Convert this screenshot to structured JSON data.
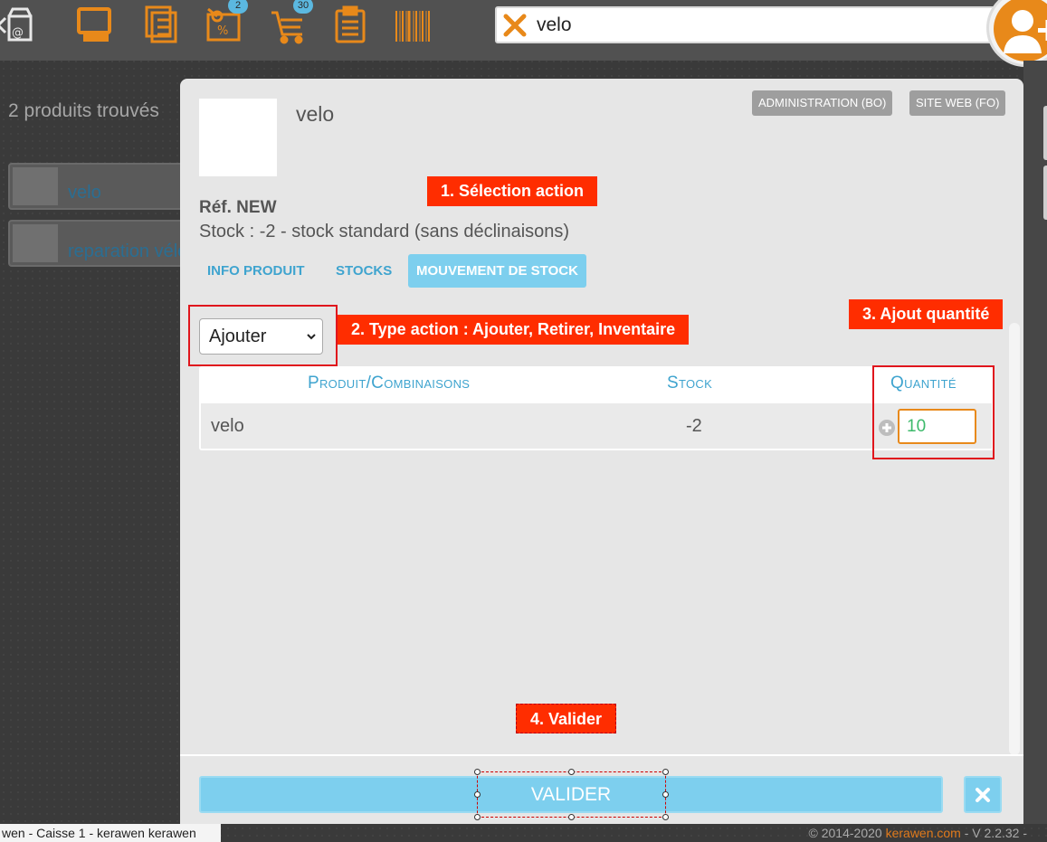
{
  "topbar": {
    "badges": {
      "promotions": "2",
      "cart": "30"
    },
    "search": {
      "value": "velo"
    }
  },
  "results": {
    "count_text": "2 produits trouvés",
    "items": [
      {
        "label": "velo"
      },
      {
        "label": "reparation vélo"
      }
    ]
  },
  "product": {
    "name": "velo",
    "ref": "Réf. NEW",
    "stock_line": "Stock : -2 - stock standard (sans déclinaisons)",
    "admin_button": "ADMINISTRATION (BO)",
    "site_button": "SITE WEB (FO)"
  },
  "tabs": [
    {
      "label": "INFO PRODUIT",
      "active": false
    },
    {
      "label": "STOCKS",
      "active": false
    },
    {
      "label": "MOUVEMENT DE STOCK",
      "active": true
    }
  ],
  "action_select": {
    "value": "Ajouter"
  },
  "table": {
    "headers": [
      "Produit/Combinaisons",
      "Stock",
      "Quantité"
    ],
    "rows": [
      {
        "product": "velo",
        "stock": "-2",
        "quantity": "10"
      }
    ]
  },
  "footer": {
    "valider_label": "VALIDER"
  },
  "annotations": {
    "step1": "1. Sélection action",
    "step2": "2. Type action : Ajouter, Retirer, Inventaire",
    "step3": "3. Ajout quantité",
    "step4": "4. Valider"
  },
  "status": {
    "left": "wen - Caisse 1 - kerawen kerawen",
    "right_prefix": "© 2014-2020 ",
    "right_brand": "kerawen.com",
    "right_suffix": " - V 2.2.32 -"
  },
  "colors": {
    "accent_orange": "#e8891a",
    "accent_blue": "#7dcfee",
    "link_blue": "#3fa4cf",
    "annotation_red": "#ff2d00"
  }
}
